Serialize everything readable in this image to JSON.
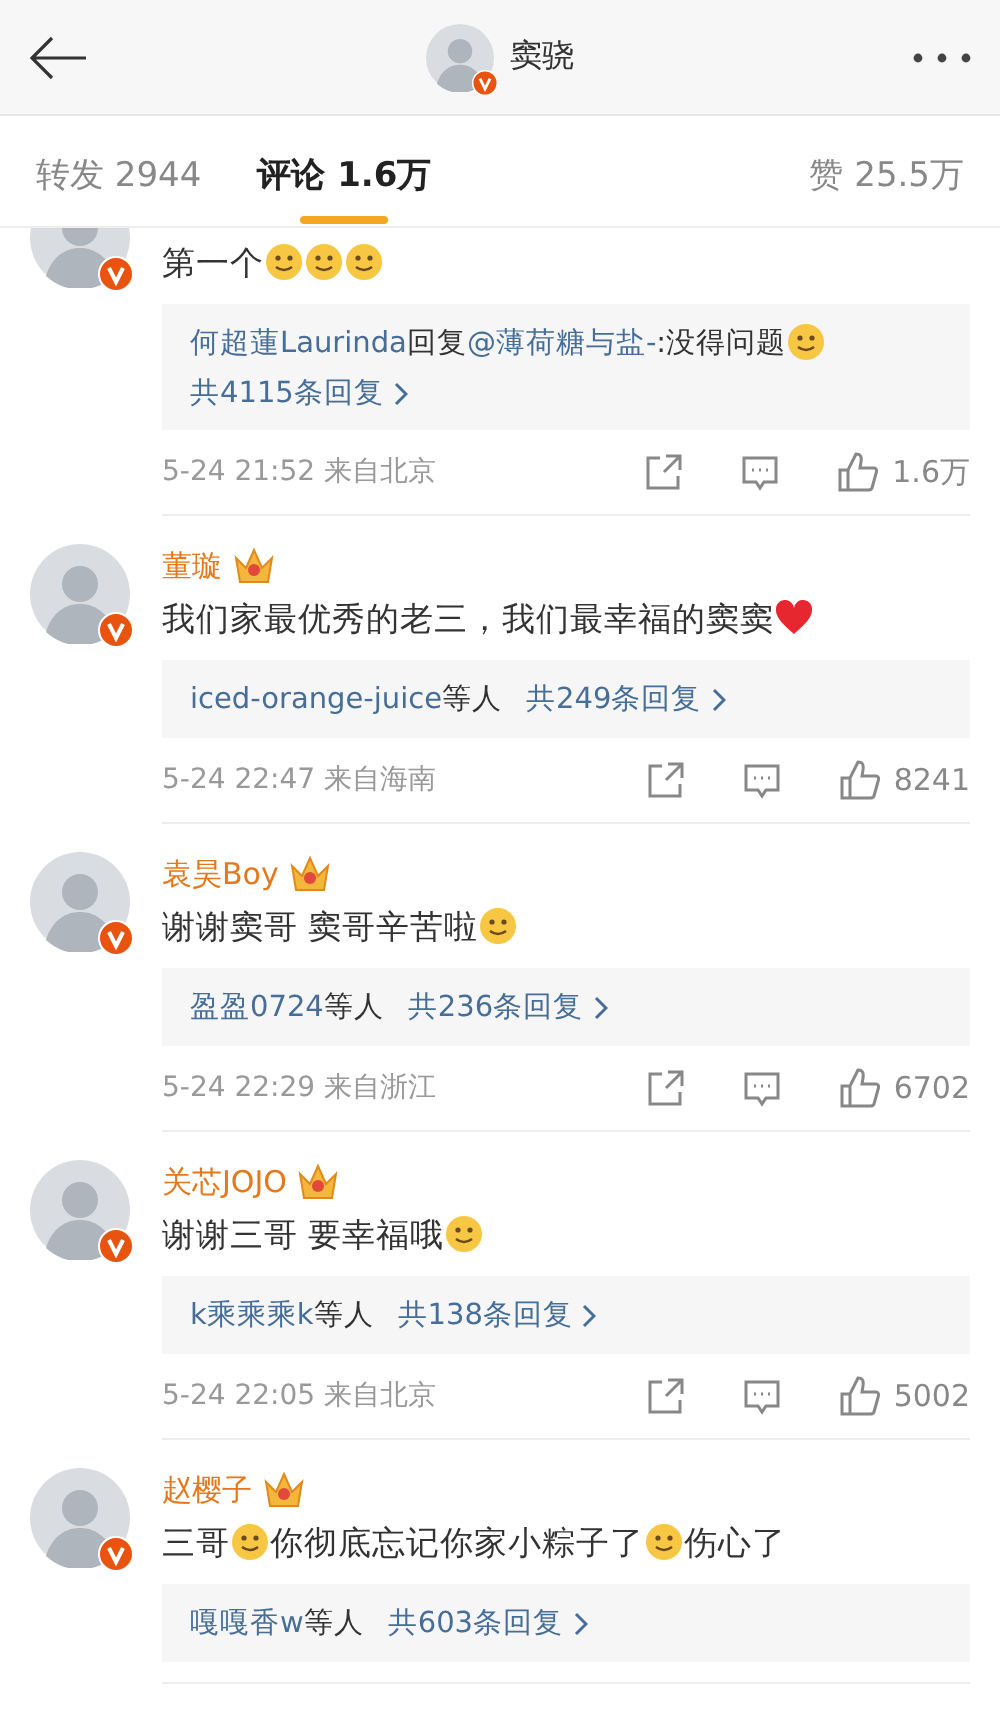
{
  "header": {
    "title": "窦骁"
  },
  "tabs": [
    {
      "label": "转发 2944",
      "selected": false
    },
    {
      "label": "评论 1.6万",
      "selected": true
    },
    {
      "label": "赞 25.5万",
      "selected": false
    }
  ],
  "comments": [
    {
      "content": [
        {
          "kind": "text",
          "text": "第一个"
        },
        {
          "kind": "emoji"
        },
        {
          "kind": "emoji"
        },
        {
          "kind": "emoji"
        }
      ],
      "reply": {
        "preview": [
          {
            "kind": "link",
            "text": "何超蓮Laurinda"
          },
          {
            "kind": "text",
            "text": "回复"
          },
          {
            "kind": "link",
            "text": "@薄荷糖与盐-"
          },
          {
            "kind": "text",
            "text": ":没得问题"
          },
          {
            "kind": "emoji"
          }
        ],
        "total": "共4115条回复"
      },
      "time": "5-24 21:52",
      "location": "来自北京",
      "likes": "1.6万"
    },
    {
      "name": "董璇",
      "content": [
        {
          "kind": "text",
          "text": "我们家最优秀的老三，我们最幸福的窦窦"
        },
        {
          "kind": "heart"
        }
      ],
      "reply": {
        "preview": [
          {
            "kind": "link",
            "text": "iced-orange-juice"
          },
          {
            "kind": "text",
            "text": "等人"
          }
        ],
        "total": "共249条回复"
      },
      "time": "5-24 22:47",
      "location": "来自海南",
      "likes": "8241"
    },
    {
      "name": "袁昊Boy",
      "content": [
        {
          "kind": "text",
          "text": "谢谢窦哥 窦哥辛苦啦"
        },
        {
          "kind": "emoji"
        }
      ],
      "reply": {
        "preview": [
          {
            "kind": "link",
            "text": "盈盈0724"
          },
          {
            "kind": "text",
            "text": "等人"
          }
        ],
        "total": "共236条回复"
      },
      "time": "5-24 22:29",
      "location": "来自浙江",
      "likes": "6702"
    },
    {
      "name": "关芯JOJO",
      "content": [
        {
          "kind": "text",
          "text": "谢谢三哥 要幸福哦"
        },
        {
          "kind": "emoji"
        }
      ],
      "reply": {
        "preview": [
          {
            "kind": "link",
            "text": "k乘乘乘k"
          },
          {
            "kind": "text",
            "text": "等人"
          }
        ],
        "total": "共138条回复"
      },
      "time": "5-24 22:05",
      "location": "来自北京",
      "likes": "5002"
    },
    {
      "name": "赵樱子",
      "content": [
        {
          "kind": "text",
          "text": "三哥"
        },
        {
          "kind": "emoji"
        },
        {
          "kind": "text",
          "text": "你彻底忘记你家小粽子了"
        },
        {
          "kind": "emoji"
        },
        {
          "kind": "text",
          "text": "伤心了"
        }
      ],
      "reply": {
        "preview": [
          {
            "kind": "link",
            "text": "嘎嘎香w"
          },
          {
            "kind": "text",
            "text": "等人"
          }
        ],
        "total": "共603条回复"
      }
    }
  ]
}
